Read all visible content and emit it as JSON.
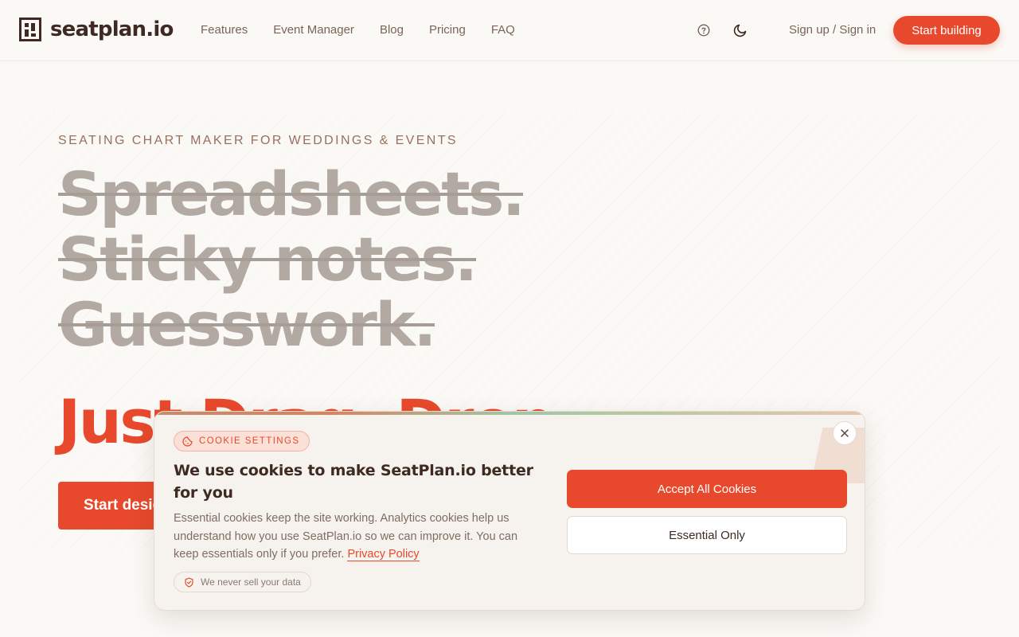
{
  "header": {
    "logo_text": "seatplan.io",
    "nav": [
      "Features",
      "Event Manager",
      "Blog",
      "Pricing",
      "FAQ"
    ],
    "signin_label": "Sign up / Sign in",
    "cta_label": "Start building"
  },
  "hero": {
    "eyebrow": "SEATING CHART MAKER FOR WEDDINGS & EVENTS",
    "struck_lines": [
      "Spreadsheets.",
      "Sticky notes.",
      "Guesswork."
    ],
    "tagline_visible": "Just Drag. Drop.",
    "cta_label": "Start designing"
  },
  "cookie": {
    "badge": "COOKIE SETTINGS",
    "title": "We use cookies to make SeatPlan.io better for you",
    "body": "Essential cookies keep the site working. Analytics cookies help us understand how you use SeatPlan.io so we can improve it. You can keep essentials only if you prefer.",
    "policy_link": "Privacy Policy",
    "note": "We never sell your data",
    "accept_label": "Accept All Cookies",
    "essential_label": "Essential Only"
  },
  "colors": {
    "accent": "#e8492c",
    "text_dark": "#3e2a23",
    "text_muted": "#7a6458",
    "background": "#fbf9f6"
  },
  "icons": {
    "help": "question-circle-icon",
    "theme": "moon-icon",
    "close": "close-icon",
    "cookie": "cookie-icon",
    "shield": "shield-check-icon"
  }
}
